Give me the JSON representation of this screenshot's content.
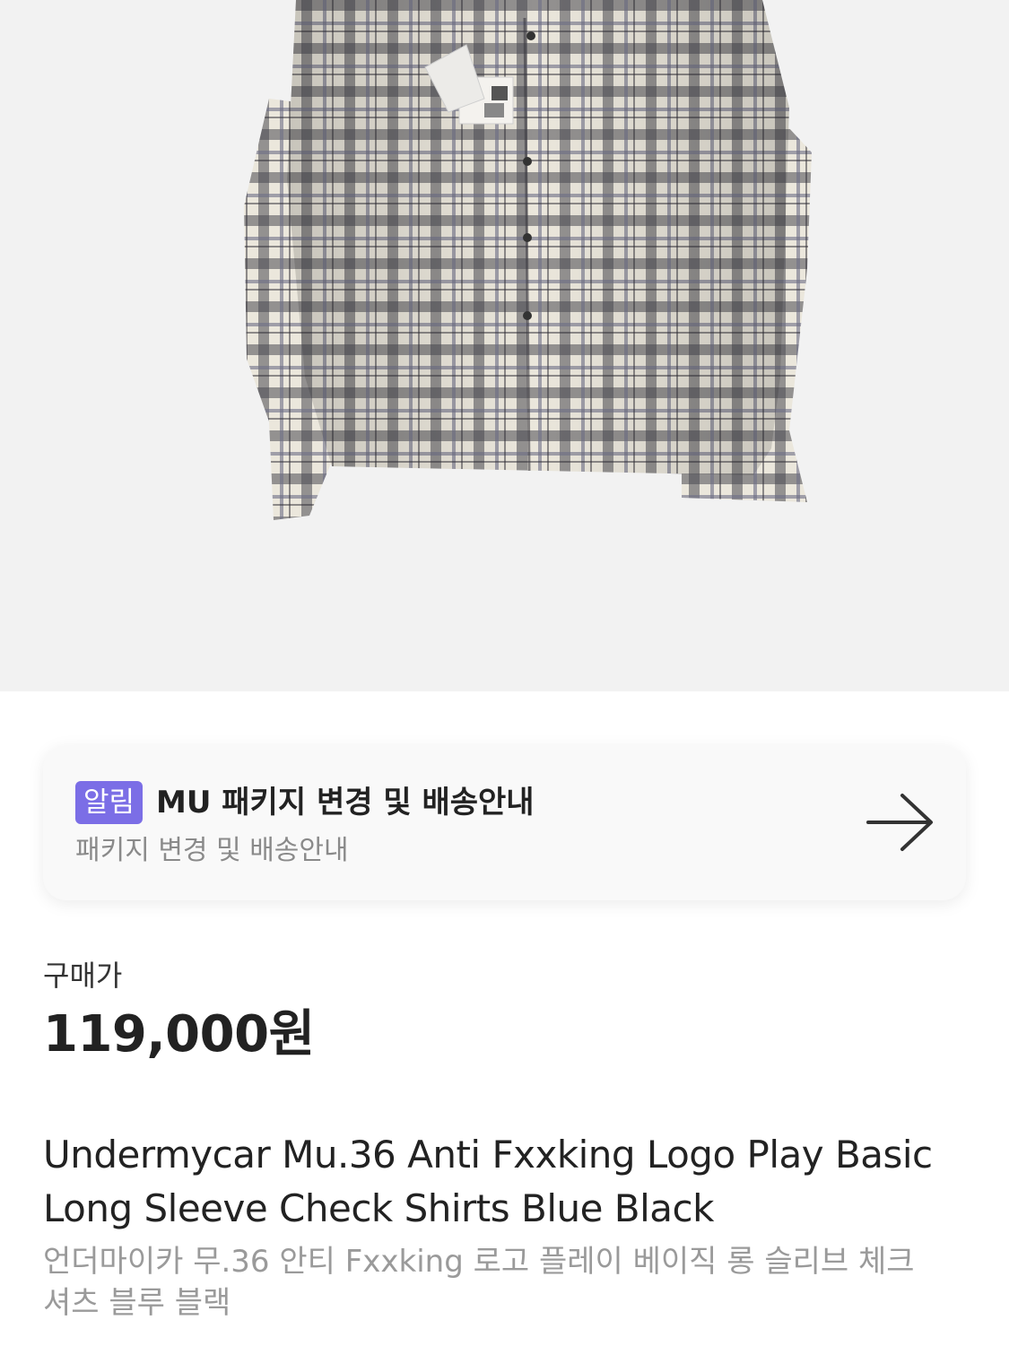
{
  "notice": {
    "badge": "알림",
    "title": "MU 패키지 변경 및 배송안내",
    "subtitle": "패키지 변경 및 배송안내"
  },
  "price": {
    "label": "구매가",
    "value": "119,000원"
  },
  "product": {
    "name_en": "Undermycar Mu.36 Anti Fxxking Logo Play Basic Long Sleeve Check Shirts Blue Black",
    "name_ko": "언더마이카 무.36 안티 Fxxking 로고 플레이 베이직 롱 슬리브 체크 셔츠 블루 블랙"
  },
  "colors": {
    "accent": "#7b6ee6",
    "hero_bg": "#f2f2f2"
  },
  "icons": {
    "notice_arrow": "arrow-right-icon"
  }
}
